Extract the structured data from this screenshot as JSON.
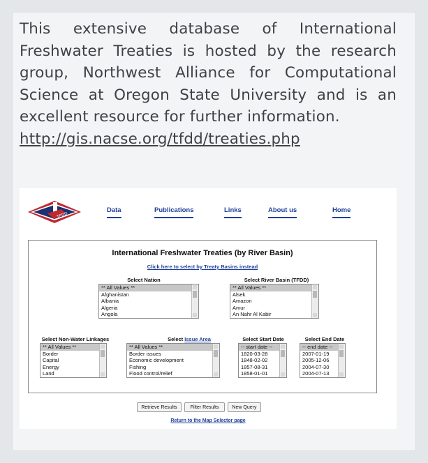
{
  "intro": {
    "text": "This extensive database of International Freshwater Treaties is hosted by the research group, Northwest Alliance for Computational Science at Oregon State University and is an excellent resource for further information.",
    "url": "http://gis.nacse.org/tfdd/treaties.php"
  },
  "site": {
    "logo_text": "TFDD",
    "nav": [
      "Data",
      "Publications",
      "Links",
      "About us",
      "Home"
    ],
    "title": "International Freshwater Treaties (by River Basin)",
    "select_link": "Click here to select by Treaty Basins instead",
    "nation": {
      "label": "Select Nation",
      "options": [
        "** All Values **",
        "Afghanistan",
        "Albania",
        "Algeria",
        "Angola"
      ]
    },
    "basin": {
      "label": "Select River Basin (TFDD)",
      "options": [
        "** All Values **",
        "Alsek",
        "Amazon",
        "Amur",
        "An Nahr Al Kabir"
      ]
    },
    "linkages": {
      "label": "Select Non-Water Linkages",
      "options": [
        "** All Values **",
        "Border",
        "Capital",
        "Energy",
        "Land"
      ]
    },
    "issue": {
      "label_prefix": "Select",
      "label_link": "Issue Area",
      "options": [
        "** All Values **",
        "Border issues",
        "Economic development",
        "Fishing",
        "Flood control/relief"
      ]
    },
    "start_date": {
      "label": "Select Start Date",
      "options": [
        "-- start date --",
        "1820-03-28",
        "1848-02-02",
        "1857-08-31",
        "1858-01-01"
      ]
    },
    "end_date": {
      "label": "Select End Date",
      "options": [
        "-- end date --",
        "2007-01-19",
        "2005-12-06",
        "2004-07-30",
        "2004-07-13"
      ]
    },
    "buttons": {
      "retrieve": "Retrieve Results",
      "filter": "Filter Results",
      "new_query": "New Query"
    },
    "return_link": "Return to the Map Selector page"
  },
  "colors": {
    "link_blue": "#1f3f9a",
    "logo_red": "#c0282d",
    "logo_navy": "#1d3170",
    "text": "#3e4145"
  }
}
